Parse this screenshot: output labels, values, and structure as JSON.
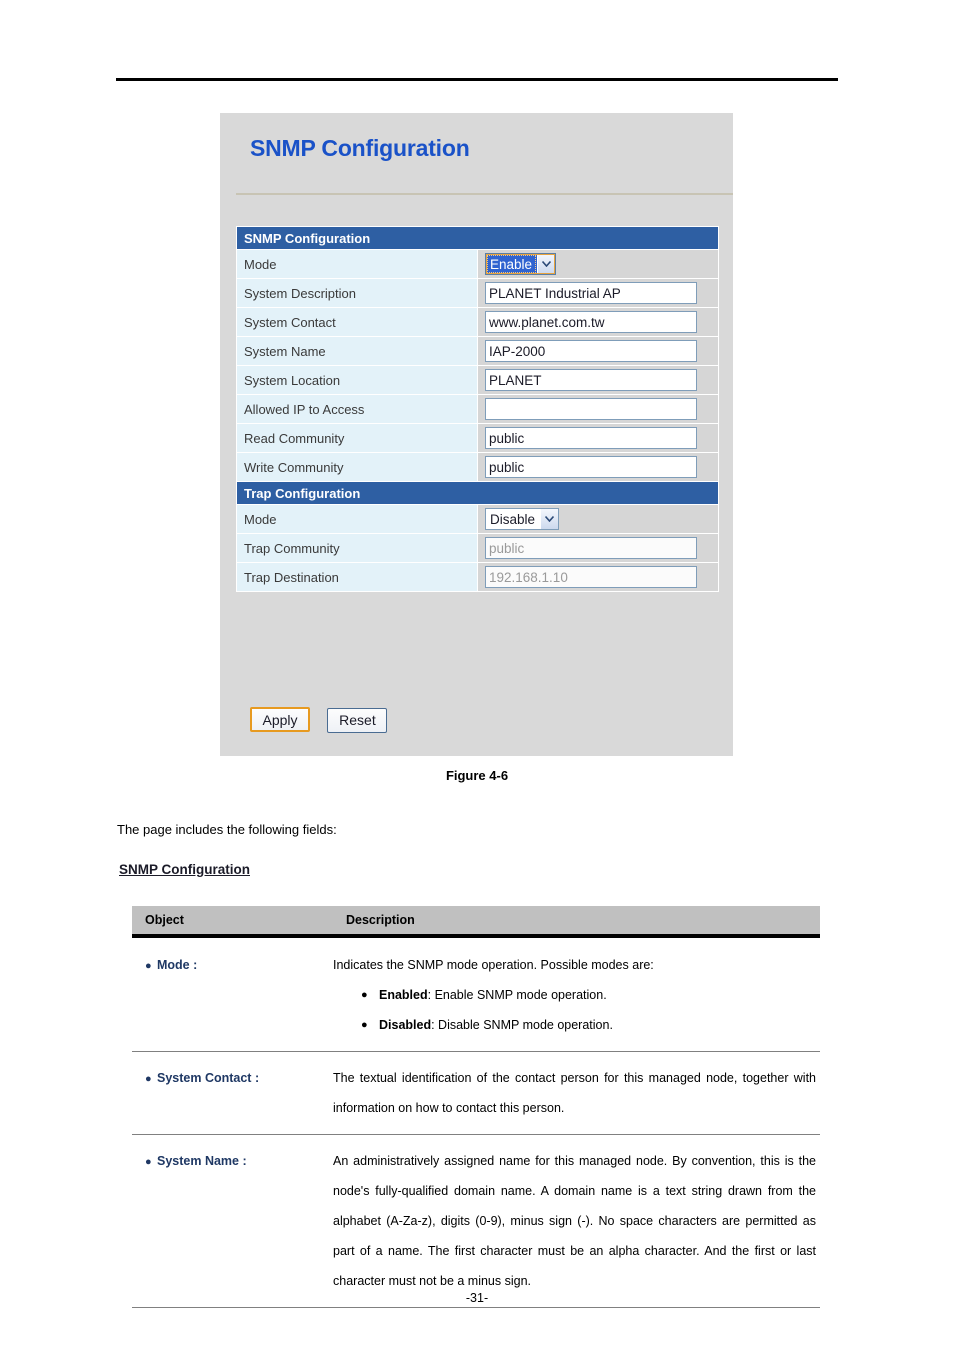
{
  "page": {
    "footer_page_number": "-31-",
    "figure_caption": "Figure 4-6",
    "intro_text": "The page includes the following fields:",
    "subhead": "SNMP Configuration"
  },
  "screenshot": {
    "title": "SNMP Configuration",
    "sections": {
      "snmp": {
        "header": "SNMP Configuration",
        "rows": [
          {
            "label": "Mode",
            "type": "select",
            "value": "Enable",
            "focused": true
          },
          {
            "label": "System Description",
            "type": "text",
            "value": "PLANET Industrial AP",
            "dim": false
          },
          {
            "label": "System Contact",
            "type": "text",
            "value": "www.planet.com.tw",
            "dim": false
          },
          {
            "label": "System Name",
            "type": "text",
            "value": "IAP-2000",
            "dim": false
          },
          {
            "label": "System Location",
            "type": "text",
            "value": "PLANET",
            "dim": false
          },
          {
            "label": "Allowed IP to Access",
            "type": "text",
            "value": "",
            "dim": false
          },
          {
            "label": "Read Community",
            "type": "text",
            "value": "public",
            "dim": false
          },
          {
            "label": "Write Community",
            "type": "text",
            "value": "public",
            "dim": false
          }
        ]
      },
      "trap": {
        "header": "Trap Configuration",
        "rows": [
          {
            "label": "Mode",
            "type": "select",
            "value": "Disable",
            "focused": false
          },
          {
            "label": "Trap Community",
            "type": "text",
            "value": "public",
            "dim": true
          },
          {
            "label": "Trap Destination",
            "type": "text",
            "value": "192.168.1.10",
            "dim": true
          }
        ]
      }
    },
    "buttons": {
      "apply": "Apply",
      "reset": "Reset"
    },
    "colors": {
      "panel_bg": "#d9d9d9",
      "title_blue": "#1a52c8",
      "section_bar": "#2e5fa3",
      "label_cell": "#e3f2f9",
      "value_cell": "#d6d6d6",
      "focus_orange": "#e79a20",
      "select_highlight": "#2f63d0"
    }
  },
  "description_table": {
    "headers": {
      "object": "Object",
      "description": "Description"
    },
    "rows": [
      {
        "object": "Mode :",
        "lead": "Indicates the SNMP mode operation. Possible modes are:",
        "items": [
          {
            "term": "Enabled",
            "text": ": Enable SNMP mode operation."
          },
          {
            "term": "Disabled",
            "text": ": Disable SNMP mode operation."
          }
        ]
      },
      {
        "object": "System Contact :",
        "lead": "The textual identification of the contact person for this managed node, together with information on how to contact this person.",
        "items": []
      },
      {
        "object": "System Name :",
        "lead": "An administratively assigned name for this managed node. By convention, this is the node's fully-qualified domain name. A domain name is a text string drawn from the alphabet (A-Za-z), digits (0-9), minus sign (-). No space characters are permitted as part of a name. The first character must be an alpha character. And the first or last character must not be a minus sign.",
        "items": []
      }
    ]
  }
}
